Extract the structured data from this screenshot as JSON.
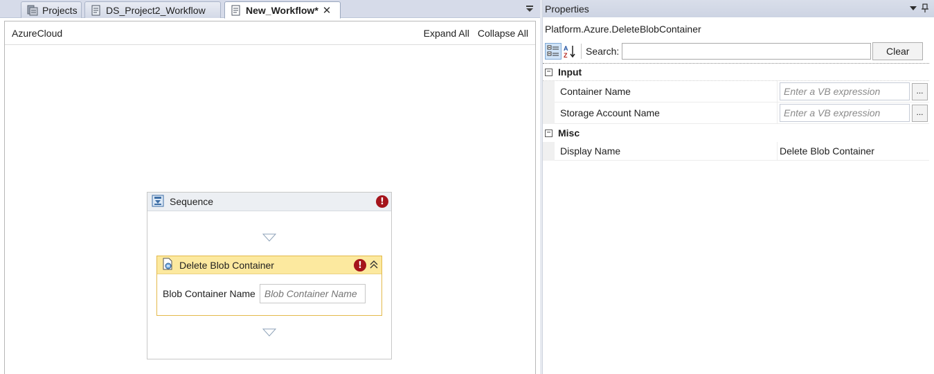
{
  "tabs": [
    {
      "label": "Projects",
      "active": false
    },
    {
      "label": "DS_Project2_Workflow",
      "active": false
    },
    {
      "label": "New_Workflow*",
      "active": true
    }
  ],
  "designer": {
    "breadcrumb": "AzureCloud",
    "expand_all": "Expand All",
    "collapse_all": "Collapse All",
    "sequence": {
      "title": "Sequence",
      "activity": {
        "title": "Delete Blob Container",
        "field_label": "Blob Container Name",
        "field_placeholder": "Blob Container Name"
      }
    },
    "error_glyph": "!"
  },
  "properties": {
    "title": "Properties",
    "type_name": "Platform.Azure.DeleteBlobContainer",
    "search_label": "Search:",
    "search_value": "",
    "clear_label": "Clear",
    "categories": [
      {
        "name": "Input",
        "rows": [
          {
            "name": "Container Name",
            "placeholder": "Enter a VB expression",
            "button": "..."
          },
          {
            "name": "Storage Account Name",
            "placeholder": "Enter a VB expression",
            "button": "..."
          }
        ]
      },
      {
        "name": "Misc",
        "rows": [
          {
            "name": "Display Name",
            "value": "Delete Blob Container"
          }
        ]
      }
    ],
    "expander_glyph": "−"
  },
  "colors": {
    "activity_header": "#fce99f",
    "activity_border": "#e3b94a",
    "error": "#a5141b",
    "tabstrip": "#d6dbe9"
  },
  "icons": [
    "projects-icon",
    "workflow-doc-icon",
    "close-icon",
    "overflow-icon",
    "sequence-icon",
    "error-icon",
    "drop-arrow-icon",
    "activity-icon",
    "collapse-icon",
    "categorized-icon",
    "alphabetical-icon",
    "menu-icon",
    "pin-icon"
  ]
}
